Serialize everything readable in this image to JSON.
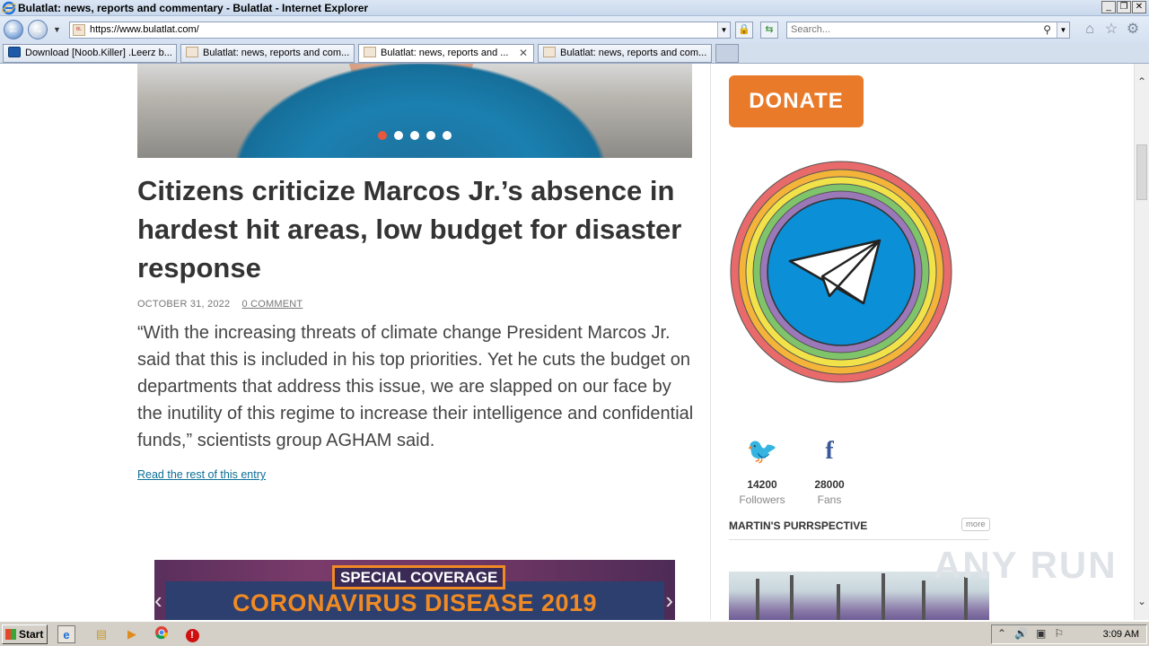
{
  "window": {
    "title": "Bulatlat: news, reports and commentary - Bulatlat - Internet Explorer",
    "controls": [
      "_",
      "❐",
      "✕"
    ]
  },
  "address_bar": {
    "url": "https://www.bulatlat.com/",
    "search_placeholder": "Search..."
  },
  "tabs": [
    {
      "label": "Download [Noob.Killer] .Leerz b...",
      "active": false
    },
    {
      "label": "Bulatlat: news, reports and com...",
      "active": false
    },
    {
      "label": "Bulatlat: news, reports and ...",
      "active": true
    },
    {
      "label": "Bulatlat: news, reports and com...",
      "active": false
    }
  ],
  "article": {
    "headline": "Citizens criticize Marcos Jr.’s absence in hardest hit areas, low budget for disaster response",
    "date": "OCTOBER 31, 2022",
    "comments": "0 COMMENT",
    "excerpt": "“With the increasing threats of climate change President Marcos Jr. said that this is included in his top priorities. Yet he cuts the budget on departments that address this issue, we are slapped on our face by the inutility of this regime to increase their intelligence and confidential funds,” scientists group AGHAM said.",
    "read_more": "Read the rest of this entry",
    "slider_active_index": 0
  },
  "banner": {
    "tag": "SPECIAL COVERAGE",
    "title": "CORONAVIRUS DISEASE 2019"
  },
  "sidebar": {
    "donate_label": "DONATE",
    "twitter": {
      "count": "14200",
      "label": "Followers"
    },
    "facebook": {
      "count": "28000",
      "label": "Fans"
    },
    "section_title": "MARTIN'S PURRSPECTIVE",
    "more_label": "more"
  },
  "watermark": "ANY RUN",
  "taskbar": {
    "start_label": "Start",
    "clock": "3:09 AM"
  },
  "colors": {
    "accent_orange": "#e97a2a",
    "link_blue": "#0d6f97",
    "telegram_blue": "#0088cc"
  }
}
